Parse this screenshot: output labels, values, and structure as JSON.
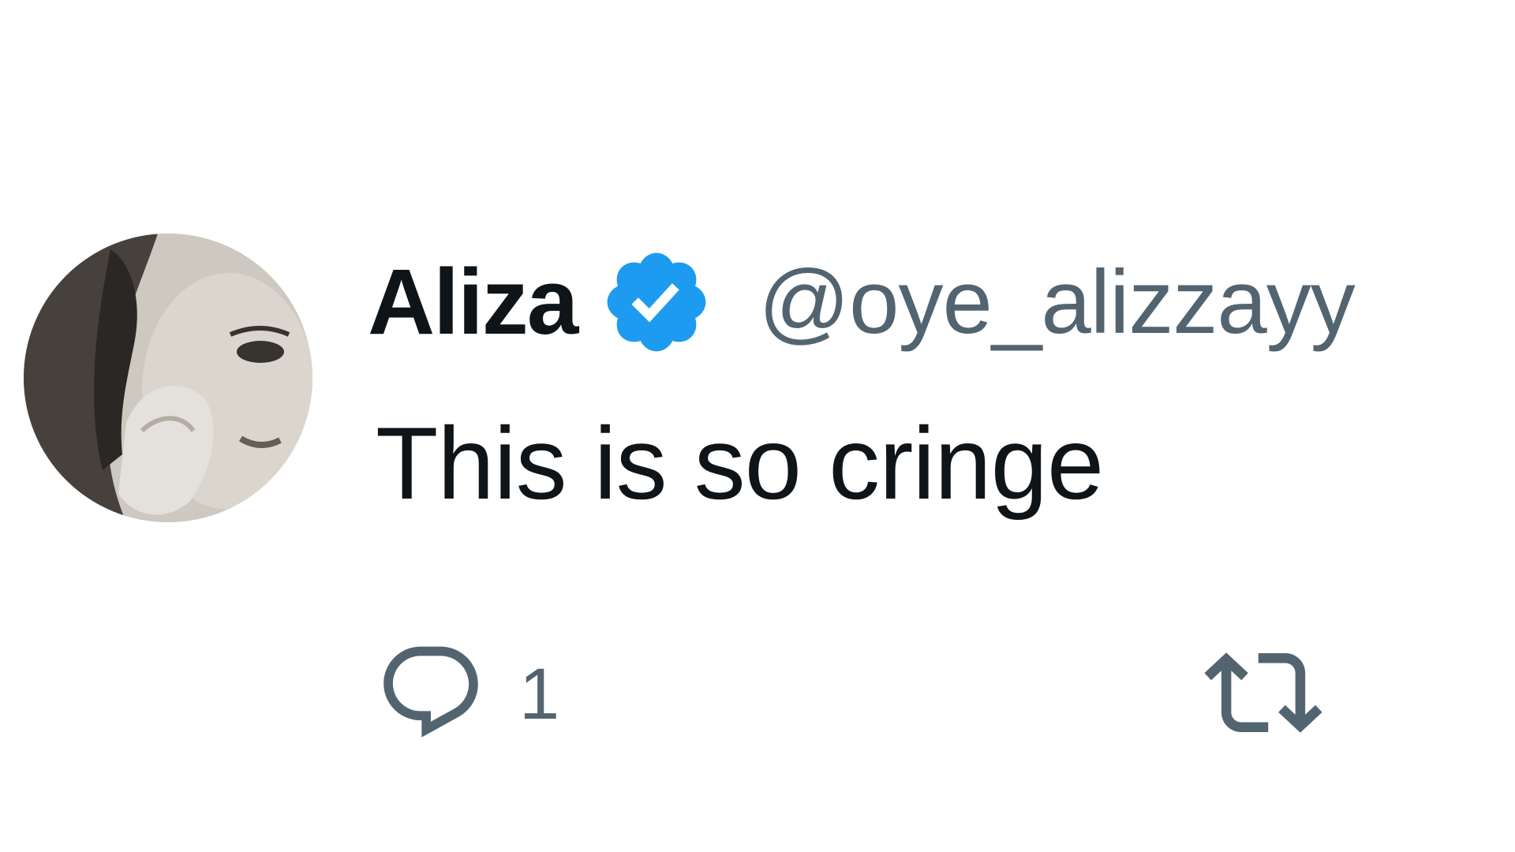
{
  "tweet": {
    "author_name": "Aliza",
    "author_handle": "@oye_alizzayy",
    "verified_icon": "verified-badge-icon",
    "text": "This is so cringe",
    "avatar_icon": "user-avatar",
    "reply": {
      "icon": "reply-bubble-icon",
      "count": "1"
    },
    "retweet": {
      "icon": "retweet-icon"
    }
  },
  "colors": {
    "text_primary": "#0f1419",
    "text_secondary": "#536471",
    "verified_blue": "#1d9bf0"
  }
}
